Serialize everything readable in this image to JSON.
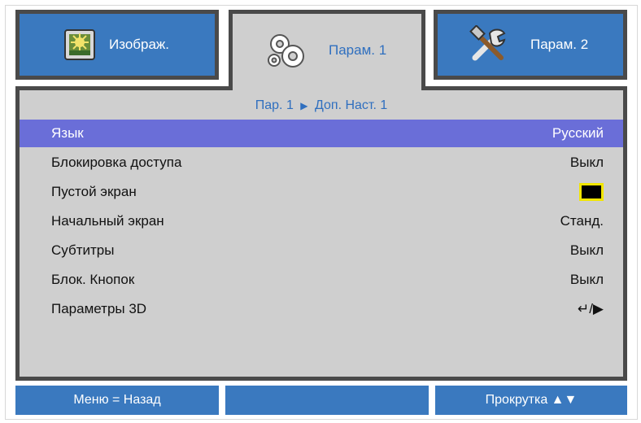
{
  "tabs": [
    {
      "label": "Изображ.",
      "icon": "image-icon"
    },
    {
      "label": "Парам. 1",
      "icon": "gears-icon"
    },
    {
      "label": "Парам. 2",
      "icon": "tools-icon"
    }
  ],
  "breadcrumb": {
    "parent": "Пар. 1",
    "separator_icon": "arrow-right-icon",
    "current": "Доп. Наст. 1"
  },
  "menu": [
    {
      "label": "Язык",
      "value": "Русский"
    },
    {
      "label": "Блокировка доступа",
      "value": "Выкл"
    },
    {
      "label": "Пустой экран",
      "value_color": "#000000"
    },
    {
      "label": "Начальный экран",
      "value": "Станд."
    },
    {
      "label": "Субтитры",
      "value": "Выкл"
    },
    {
      "label": "Блок. Кнопок",
      "value": "Выкл"
    },
    {
      "label": "Параметры 3D",
      "value": "↵/▶"
    }
  ],
  "status": {
    "left": "Меню = Назад",
    "middle": "",
    "right": "Прокрутка ▲▼"
  },
  "colors": {
    "accent_blue": "#3a79bf",
    "selected_row": "#6a6ed8",
    "panel_bg": "#cfcfcf",
    "tab_text_active": "#2f6fbf"
  }
}
